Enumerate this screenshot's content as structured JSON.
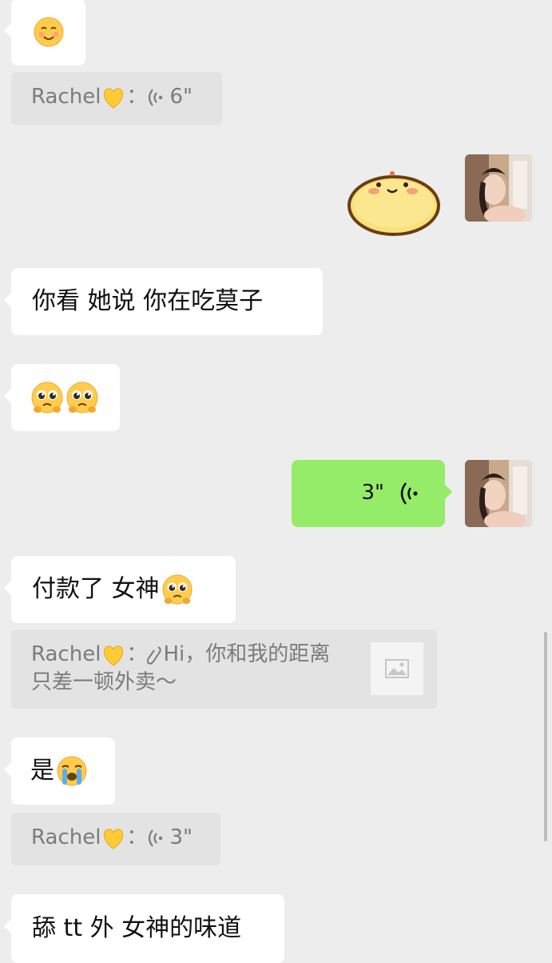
{
  "messages": {
    "m1": {
      "emoji": "smiling-face-with-blush"
    },
    "q1": {
      "sender": "Rachel",
      "sep": "：",
      "duration": "6\""
    },
    "m2": {
      "sticker": "round-yellow-bun-sticker"
    },
    "m3": {
      "text": "你看 她说 你在吃莫子"
    },
    "m4": {
      "emoji": "pleading-face-pair"
    },
    "m5": {
      "duration": "3\""
    },
    "m6": {
      "text": "付款了 女神"
    },
    "q2": {
      "sender": "Rachel",
      "sep": "：",
      "line1": "Hi，你和我的距离",
      "line2": "只差一顿外卖～"
    },
    "m7": {
      "text": "是"
    },
    "q3": {
      "sender": "Rachel",
      "sep": "：",
      "duration": "3\""
    },
    "m8": {
      "text": "舔 tt 外 女神的味道"
    }
  },
  "colors": {
    "background": "#ededed",
    "incoming_bubble": "#ffffff",
    "outgoing_bubble": "#95ec69",
    "quote_bg": "#e3e3e3",
    "quote_text": "#7b7b7b"
  }
}
